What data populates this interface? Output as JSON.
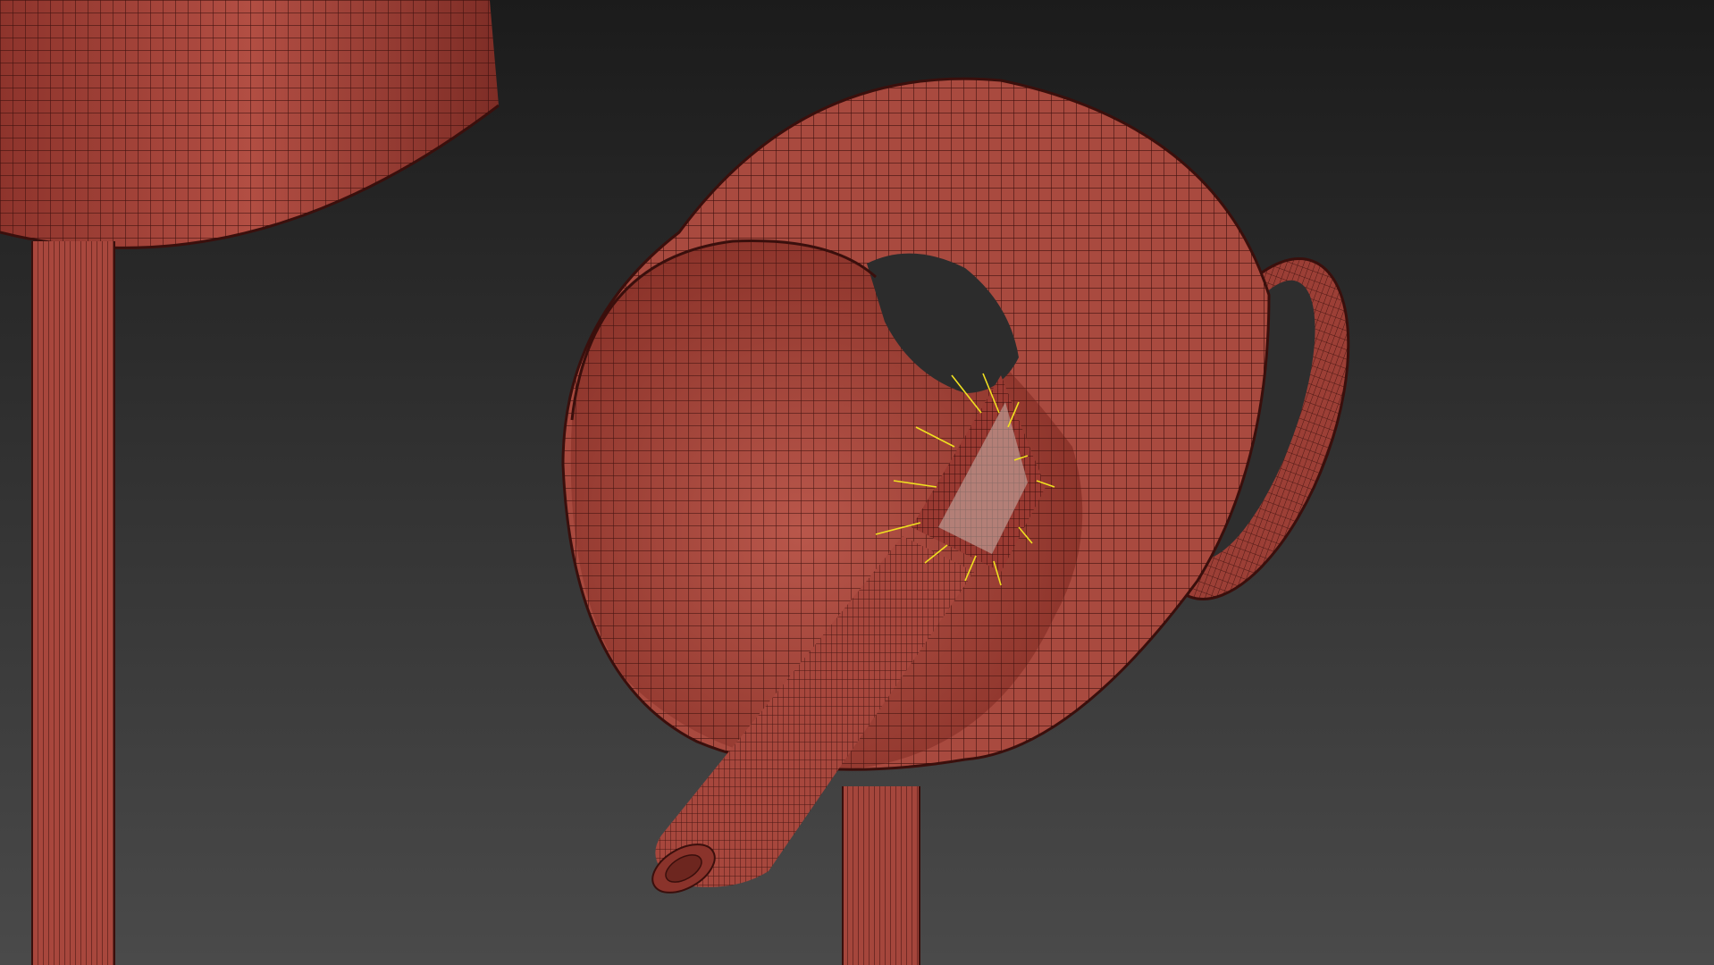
{
  "viewport": {
    "background_top": "#1b1b1b",
    "background_bottom": "#4a4a4a"
  },
  "colors": {
    "mesh_fill": "#a6463c",
    "mesh_fill_light": "#bd5a4e",
    "mesh_fill_dark": "#7a2e26",
    "wire": "#3a0f0c",
    "led_lines": "#f0e020",
    "led_fill": "#9a3a32"
  },
  "objects": [
    {
      "name": "floor-lamp-shade-upper-left",
      "kind": "lamp-shade"
    },
    {
      "name": "floor-lamp-pole-left",
      "kind": "pole"
    },
    {
      "name": "spotlight-cylinder-shade",
      "kind": "lamp-shade"
    },
    {
      "name": "spotlight-handle",
      "kind": "handle"
    },
    {
      "name": "spotlight-arm",
      "kind": "arm"
    },
    {
      "name": "spotlight-pole",
      "kind": "pole"
    },
    {
      "name": "led-emitter",
      "kind": "light"
    }
  ]
}
